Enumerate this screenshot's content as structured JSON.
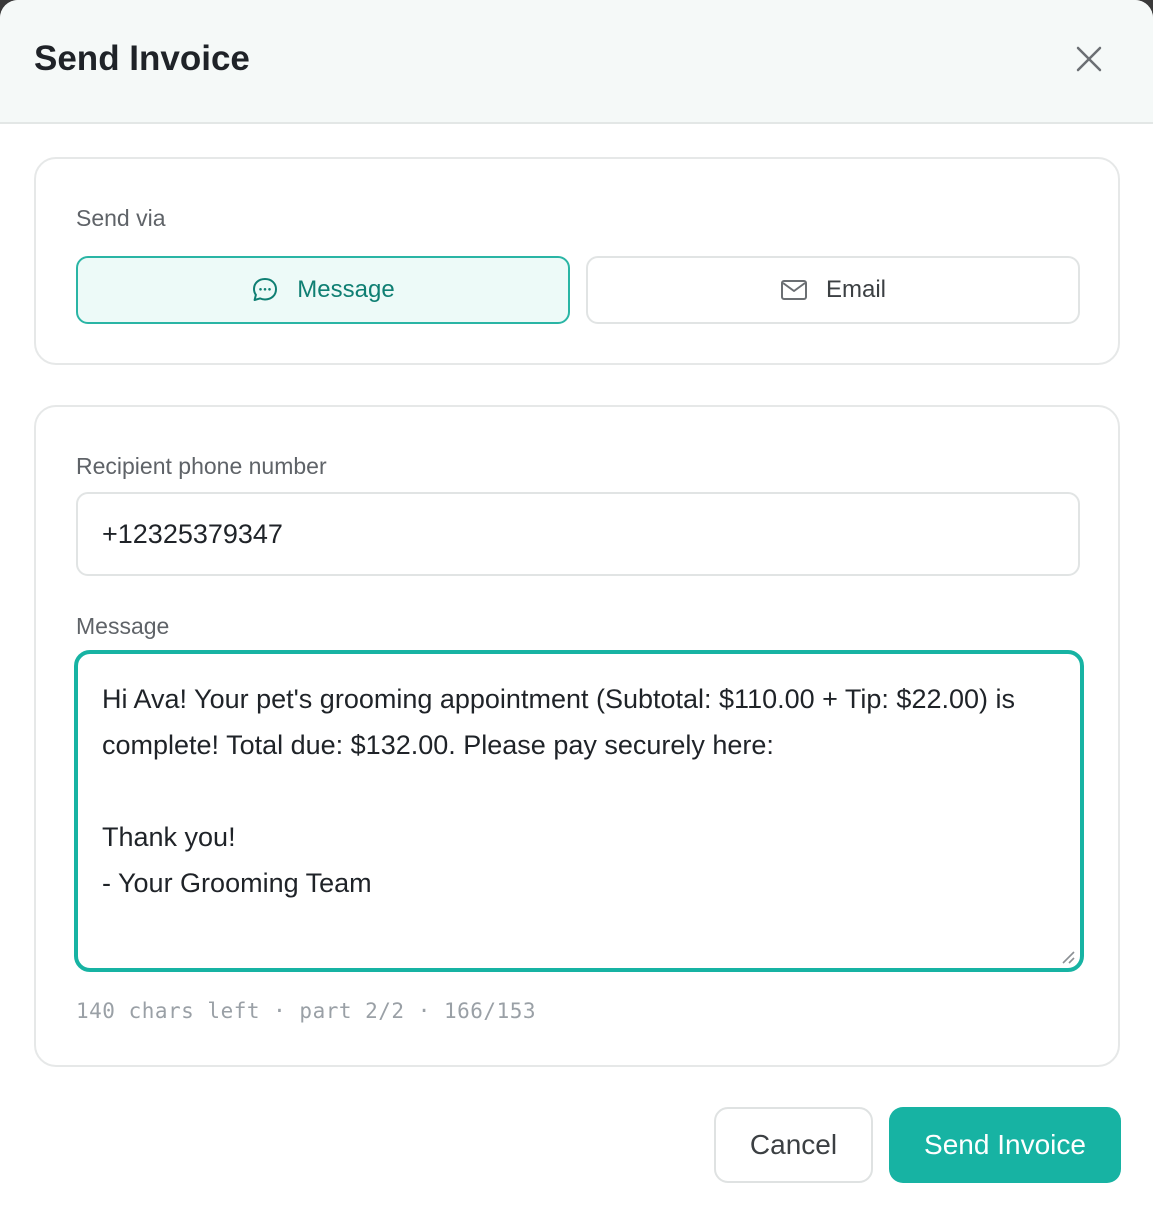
{
  "dialog": {
    "title": "Send Invoice",
    "close_icon": "close-icon"
  },
  "send_via": {
    "label": "Send via",
    "options": [
      {
        "label": "Message",
        "icon": "chat-bubble-icon",
        "selected": true
      },
      {
        "label": "Email",
        "icon": "envelope-icon",
        "selected": false
      }
    ]
  },
  "recipient": {
    "label": "Recipient phone number",
    "value": "+12325379347"
  },
  "message": {
    "label": "Message",
    "value": "Hi Ava! Your pet's grooming appointment (Subtotal: $110.00 + Tip: $22.00) is complete! Total due: $132.00. Please pay securely here:\n\nThank you!\n- Your Grooming Team",
    "counter": "140 chars left · part 2/2 · 166/153"
  },
  "footer": {
    "cancel_label": "Cancel",
    "send_label": "Send Invoice"
  },
  "colors": {
    "accent": "#17b3a3",
    "accent_dark": "#0f7f73",
    "accent_light": "#edfaf8",
    "header_bg": "#f5f9f8"
  }
}
